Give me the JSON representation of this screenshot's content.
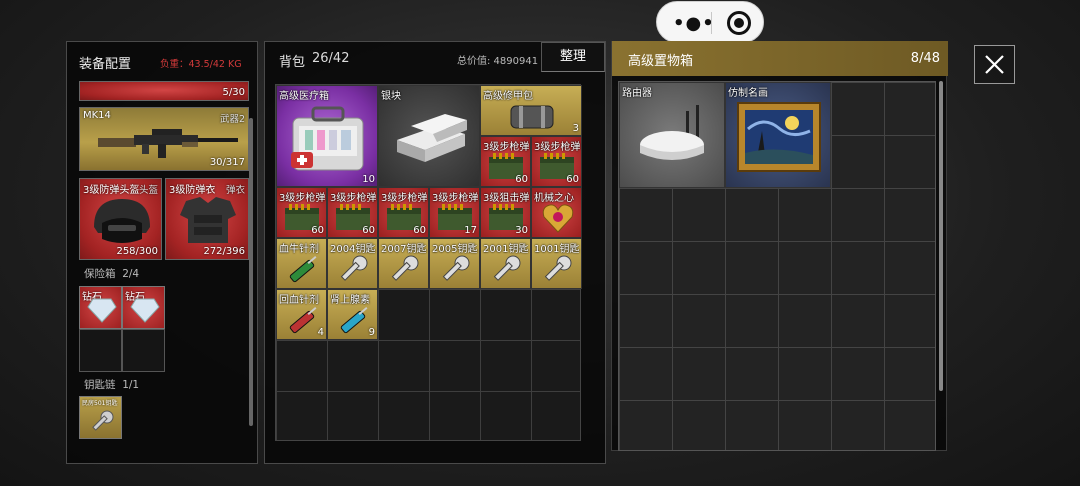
{
  "top_capsule": {
    "menu_icon": "more-dots-icon",
    "close_icon": "target-close-icon"
  },
  "equipment": {
    "title": "装备配置",
    "weight": "负重：43.5/42 KG",
    "top_slot": {
      "durability": "5/30"
    },
    "weapon": {
      "name": "MK14",
      "slot": "武器2",
      "ammo": "30/317"
    },
    "helmet": {
      "name": "3级防弹头盔",
      "slot": "头盔",
      "durability": "258/300"
    },
    "armor": {
      "name": "3级防弹衣",
      "slot": "弹衣",
      "durability": "272/396"
    },
    "safebox": {
      "label": "保险箱",
      "count": "2/4",
      "items": [
        "钻石",
        "钻石"
      ]
    },
    "keychain": {
      "label": "钥匙链",
      "count": "1/1",
      "item": "民房501钥匙"
    }
  },
  "backpack": {
    "title": "背包",
    "count": "26/42",
    "total_value": "总价值: 4890941",
    "sort_button": "整理",
    "items": [
      {
        "name": "高级医疗箱",
        "qty": "10",
        "rarity": "purple"
      },
      {
        "name": "银块",
        "qty": "",
        "rarity": "gray"
      },
      {
        "name": "高级修甲包",
        "qty": "3",
        "rarity": "gold"
      },
      {
        "name": "3级步枪弹",
        "qty": "60",
        "rarity": "red"
      },
      {
        "name": "3级步枪弹",
        "qty": "60",
        "rarity": "red"
      },
      {
        "name": "3级步枪弹",
        "qty": "60",
        "rarity": "red"
      },
      {
        "name": "3级步枪弹",
        "qty": "60",
        "rarity": "red"
      },
      {
        "name": "3级步枪弹",
        "qty": "60",
        "rarity": "red"
      },
      {
        "name": "3级步枪弹",
        "qty": "17",
        "rarity": "red"
      },
      {
        "name": "3级狙击弹",
        "qty": "30",
        "rarity": "red"
      },
      {
        "name": "机械之心",
        "qty": "",
        "rarity": "red"
      },
      {
        "name": "血牛针剂",
        "qty": "",
        "rarity": "gold"
      },
      {
        "name": "2004钥匙",
        "qty": "",
        "rarity": "gold"
      },
      {
        "name": "2007钥匙",
        "qty": "",
        "rarity": "gold"
      },
      {
        "name": "2005钥匙",
        "qty": "",
        "rarity": "gold"
      },
      {
        "name": "2001钥匙",
        "qty": "",
        "rarity": "gold"
      },
      {
        "name": "1001钥匙",
        "qty": "",
        "rarity": "gold"
      },
      {
        "name": "回血针剂",
        "qty": "4",
        "rarity": "gold"
      },
      {
        "name": "肾上腺素",
        "qty": "9",
        "rarity": "gold"
      }
    ]
  },
  "storage": {
    "title": "高级置物箱",
    "count": "8/48",
    "items": [
      {
        "name": "路由器",
        "rarity": "lightgray"
      },
      {
        "name": "仿制名画",
        "rarity": "blue"
      }
    ]
  },
  "close_icon": "close-x-icon"
}
